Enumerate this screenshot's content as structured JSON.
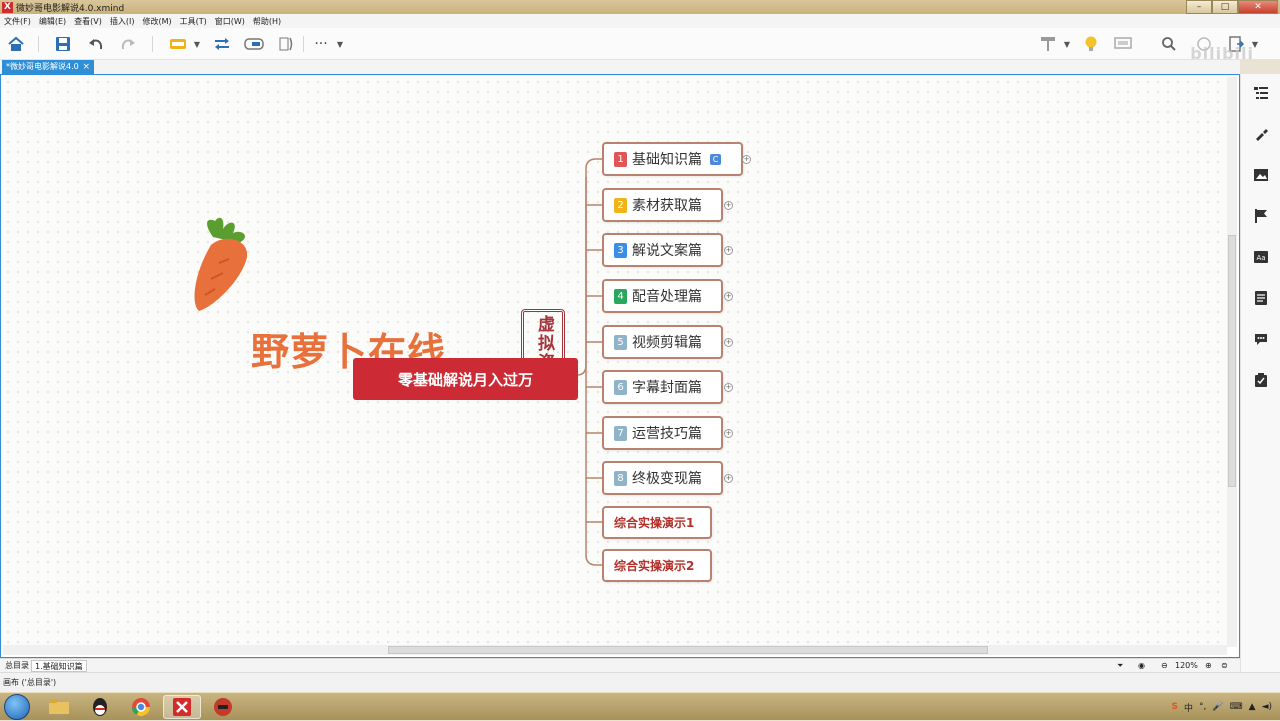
{
  "window": {
    "title": "微妙哥电影解说4.0.xmind",
    "app_icon": "X"
  },
  "menu": [
    "文件(F)",
    "编辑(E)",
    "查看(V)",
    "插入(I)",
    "修改(M)",
    "工具(T)",
    "窗口(W)",
    "帮助(H)"
  ],
  "watermark": "bilibili",
  "tab": {
    "label": "*微妙哥电影解说4.0",
    "close": "×"
  },
  "logo": {
    "text": "野萝卜在线",
    "seal": "虚拟资源"
  },
  "central_topic": "零基础解说月入过万",
  "topics": [
    {
      "num": "1",
      "label": "基础知识篇",
      "color": "#e05555",
      "badge": "C",
      "expander": "+"
    },
    {
      "num": "2",
      "label": "素材获取篇",
      "color": "#f0b418",
      "expander": "+"
    },
    {
      "num": "3",
      "label": "解说文案篇",
      "color": "#3a8ee6",
      "expander": "+"
    },
    {
      "num": "4",
      "label": "配音处理篇",
      "color": "#27a85c",
      "expander": "+"
    },
    {
      "num": "5",
      "label": "视频剪辑篇",
      "color": "#8fb3c9",
      "expander": "+"
    },
    {
      "num": "6",
      "label": "字幕封面篇",
      "color": "#8fb3c9",
      "expander": "+"
    },
    {
      "num": "7",
      "label": "运营技巧篇",
      "color": "#8fb3c9",
      "expander": "+"
    },
    {
      "num": "8",
      "label": "终极变现篇",
      "color": "#8fb3c9",
      "expander": "+"
    },
    {
      "label": "综合实操演示1"
    },
    {
      "label": "综合实操演示2"
    }
  ],
  "sheets": [
    "总目录",
    "1.基础知识篇"
  ],
  "zoom": "120%",
  "status": "画布 ('总目录')",
  "tray": {
    "ime": "中"
  }
}
